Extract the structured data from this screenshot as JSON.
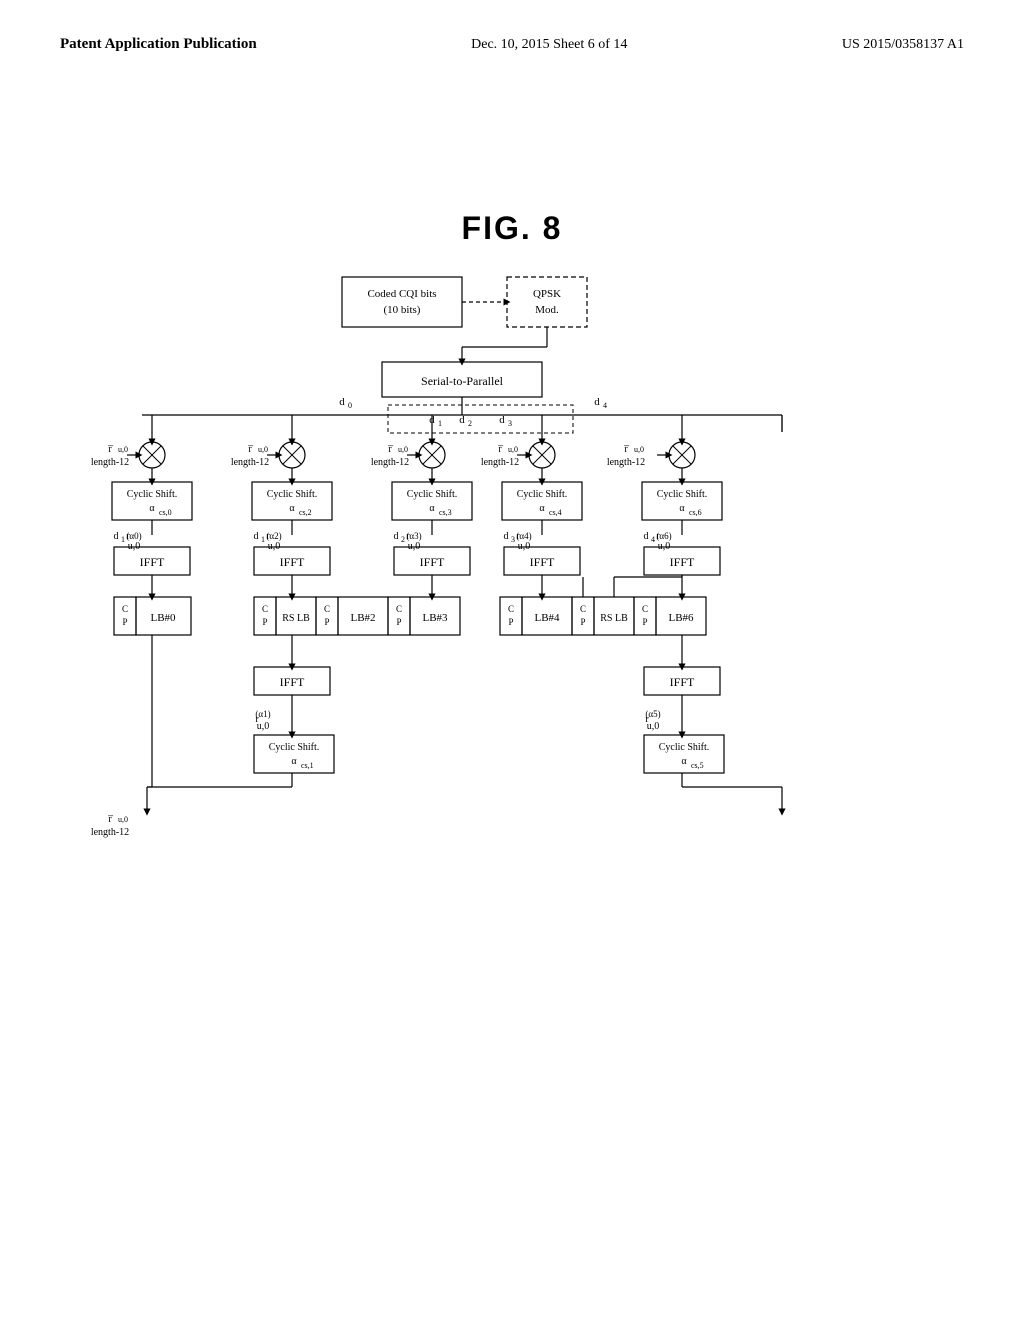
{
  "header": {
    "left": "Patent Application Publication",
    "center": "Dec. 10, 2015   Sheet 6 of 14",
    "right": "US 2015/0358137 A1"
  },
  "fig": {
    "title": "FIG.  8"
  }
}
